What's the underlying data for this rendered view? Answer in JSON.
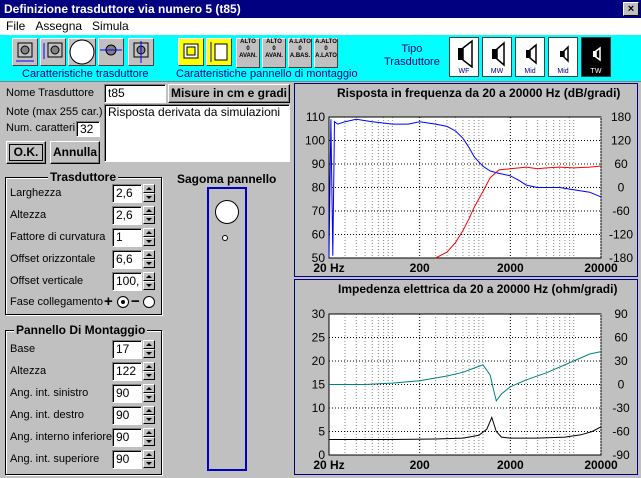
{
  "window": {
    "title": "Definizione trasduttore via numero 5 (t85)",
    "close_label": "×"
  },
  "menu": [
    "File",
    "Assegna",
    "Simula"
  ],
  "toolbar": {
    "caratteristiche_trasduttore": "Caratteristiche trasduttore",
    "caratteristiche_pannello": "Caratteristiche pannello di montaggio",
    "tipo_label": "Tipo\nTrasduttore",
    "panel_buttons": [
      {
        "top": "ALTO",
        "mid": "0",
        "bot": "AVAN."
      },
      {
        "top": "ALTO",
        "mid": "0",
        "bot": "AVAN."
      },
      {
        "top": "A.LATO",
        "mid": "0",
        "bot": "A.BAS."
      },
      {
        "top": "A.ALTO",
        "mid": "0",
        "bot": "A.LATO"
      }
    ],
    "types": [
      {
        "label": "WF",
        "selected": false
      },
      {
        "label": "MW",
        "selected": false
      },
      {
        "label": "Mid",
        "selected": false
      },
      {
        "label": "Mid",
        "selected": false
      },
      {
        "label": "TW",
        "selected": true
      }
    ]
  },
  "form": {
    "nome_label": "Nome Trasduttore",
    "nome_value": "t85",
    "misure_button": "Misure in cm e gradi",
    "note_label": "Note (max 255 car.)",
    "note_value": "Risposta derivata da simulazioni",
    "num_label": "Num. caratteri",
    "num_value": "32",
    "ok_button": "O.K.",
    "annulla_button": "Annulla"
  },
  "trasduttore": {
    "title": "Trasduttore",
    "fields": [
      {
        "label": "Larghezza",
        "value": "2,6"
      },
      {
        "label": "Altezza",
        "value": "2,6"
      },
      {
        "label": "Fattore di curvatura",
        "value": "1"
      },
      {
        "label": "Offset orizzontale",
        "value": "6,6"
      },
      {
        "label": "Offset verticale",
        "value": "100,"
      }
    ],
    "fase_label": "Fase collegamento",
    "fase_plus": "+",
    "fase_minus": "−"
  },
  "pannello": {
    "title": "Pannello Di Montaggio",
    "fields": [
      {
        "label": "Base",
        "value": "17"
      },
      {
        "label": "Altezza",
        "value": "122"
      },
      {
        "label": "Ang. int. sinistro",
        "value": "90"
      },
      {
        "label": "Ang. int. destro",
        "value": "90"
      },
      {
        "label": "Ang. interno inferiore",
        "value": "90"
      },
      {
        "label": "Ang. int. superiore",
        "value": "90"
      }
    ]
  },
  "sagoma": {
    "title": "Sagoma pannello"
  },
  "chart_data": [
    {
      "type": "line",
      "title": "Risposta in frequenza da 20 a 20000 Hz (dB/gradi)",
      "x_scale": "log",
      "xlim": [
        20,
        20000
      ],
      "x_ticks": [
        "20 Hz",
        "200",
        "2000",
        "20000"
      ],
      "ylim_left": [
        50,
        110
      ],
      "y_ticks_left": [
        "110",
        "100",
        "90",
        "80",
        "70",
        "60",
        "50"
      ],
      "ylim_right": [
        -180,
        180
      ],
      "y_ticks_right": [
        "180",
        "120",
        "60",
        "0",
        "-60",
        "-120",
        "-180"
      ],
      "grid": true,
      "series": [
        {
          "color": "#0000ff",
          "axis": "left",
          "x": [
            20,
            21,
            22,
            23,
            25,
            30,
            40,
            60,
            100,
            150,
            200,
            300,
            400,
            500,
            600,
            700,
            800,
            1000,
            1200,
            1500,
            2000,
            2500,
            3000,
            4000,
            5000,
            7000,
            10000,
            15000,
            20000
          ],
          "y": [
            50,
            109,
            51,
            108,
            107,
            108,
            109,
            108,
            107,
            107,
            108,
            107,
            106,
            104,
            101,
            97,
            93,
            89,
            87,
            86,
            85,
            83,
            81,
            80,
            80,
            80,
            79,
            78,
            76
          ]
        },
        {
          "color": "#ff0000",
          "axis": "right",
          "x": [
            300,
            400,
            500,
            600,
            700,
            800,
            1000,
            1200,
            1500,
            2000,
            2500,
            3000,
            4000,
            5000,
            7000,
            10000,
            15000,
            20000
          ],
          "y": [
            -180,
            -165,
            -140,
            -110,
            -80,
            -50,
            -10,
            25,
            45,
            48,
            50,
            52,
            48,
            50,
            52,
            50,
            52,
            55
          ]
        }
      ]
    },
    {
      "type": "line",
      "title": "Impedenza elettrica da 20 a 20000 Hz (ohm/gradi)",
      "x_scale": "log",
      "xlim": [
        20,
        20000
      ],
      "x_ticks": [
        "20 Hz",
        "200",
        "2000",
        "20000"
      ],
      "ylim_left": [
        0,
        30
      ],
      "y_ticks_left": [
        "30",
        "25",
        "20",
        "15",
        "10",
        "5",
        "0"
      ],
      "ylim_right": [
        -90,
        90
      ],
      "y_ticks_right": [
        "90",
        "60",
        "30",
        "0",
        "-30",
        "-60",
        "-90"
      ],
      "grid": true,
      "series": [
        {
          "color": "#008080",
          "axis": "left",
          "x": [
            20,
            50,
            100,
            200,
            400,
            600,
            800,
            1000,
            1200,
            1300,
            1400,
            1600,
            2000,
            3000,
            5000,
            10000,
            15000,
            20000
          ],
          "y": [
            15,
            15,
            15.3,
            15.8,
            16.8,
            17.6,
            18.5,
            19.2,
            17,
            14,
            11.5,
            13,
            14.5,
            16,
            17.5,
            20,
            21.5,
            22
          ]
        },
        {
          "color": "#000000",
          "axis": "left",
          "x": [
            20,
            100,
            300,
            600,
            900,
            1100,
            1250,
            1400,
            1600,
            2000,
            4000,
            8000,
            12000,
            16000,
            20000
          ],
          "y": [
            3.3,
            3.3,
            3.4,
            3.6,
            4.2,
            5.5,
            8,
            5,
            3.8,
            3.6,
            3.6,
            3.8,
            4.3,
            5,
            6
          ]
        }
      ]
    }
  ]
}
